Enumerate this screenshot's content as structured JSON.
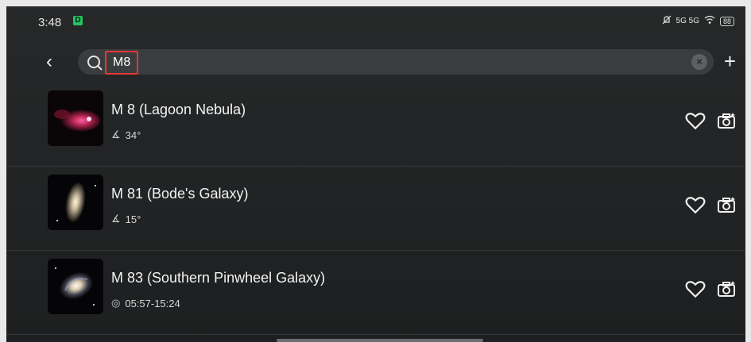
{
  "status_bar": {
    "time": "3:48",
    "app_badge": "D",
    "signal_text": "5G 5G",
    "battery": "88"
  },
  "search": {
    "query": "M8",
    "back_icon": "chevron-left-icon",
    "clear_icon": "close-icon",
    "add_icon": "plus-icon"
  },
  "results": [
    {
      "name": "M 8 (Lagoon Nebula)",
      "meta_icon": "angle-icon",
      "meta": "34°"
    },
    {
      "name": "M 81 (Bode's Galaxy)",
      "meta_icon": "angle-icon",
      "meta": "15°"
    },
    {
      "name": "M 83 (Southern Pinwheel Galaxy)",
      "meta_icon": "eye-icon",
      "meta": "05:57-15:24"
    }
  ],
  "colors": {
    "background": "#1f2122",
    "highlight_box": "#e53935"
  }
}
